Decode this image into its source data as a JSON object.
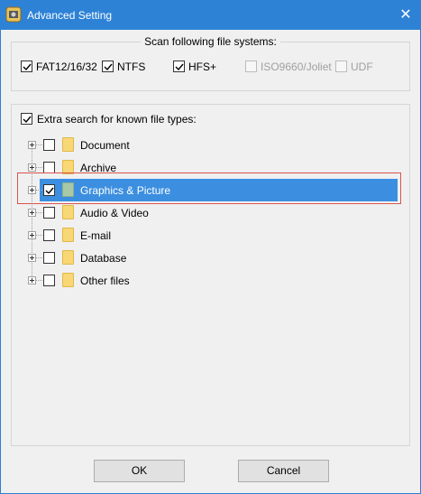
{
  "window": {
    "title": "Advanced Setting",
    "close_glyph": "✕"
  },
  "file_systems": {
    "legend": "Scan following file systems:",
    "items": [
      {
        "label": "FAT12/16/32",
        "checked": true,
        "enabled": true
      },
      {
        "label": "NTFS",
        "checked": true,
        "enabled": true
      },
      {
        "label": "HFS+",
        "checked": true,
        "enabled": true
      },
      {
        "label": "ISO9660/Joliet",
        "checked": false,
        "enabled": false
      },
      {
        "label": "UDF",
        "checked": false,
        "enabled": false
      }
    ]
  },
  "file_types": {
    "extra_label": "Extra search for known file types:",
    "extra_checked": true,
    "tree": [
      {
        "label": "Document",
        "checked": false,
        "selected": false,
        "icon": "folder-icon"
      },
      {
        "label": "Archive",
        "checked": false,
        "selected": false,
        "icon": "folder-icon"
      },
      {
        "label": "Graphics & Picture",
        "checked": true,
        "selected": true,
        "icon": "folder-icon"
      },
      {
        "label": "Audio & Video",
        "checked": false,
        "selected": false,
        "icon": "folder-icon"
      },
      {
        "label": "E-mail",
        "checked": false,
        "selected": false,
        "icon": "folder-icon"
      },
      {
        "label": "Database",
        "checked": false,
        "selected": false,
        "icon": "folder-icon"
      },
      {
        "label": "Other files",
        "checked": false,
        "selected": false,
        "icon": "folder-icon"
      }
    ]
  },
  "buttons": {
    "ok": "OK",
    "cancel": "Cancel"
  },
  "colors": {
    "titlebar": "#2d82d6",
    "selection": "#3c8fe0",
    "highlight_box": "#d9534f",
    "folder": "#f8d775"
  }
}
